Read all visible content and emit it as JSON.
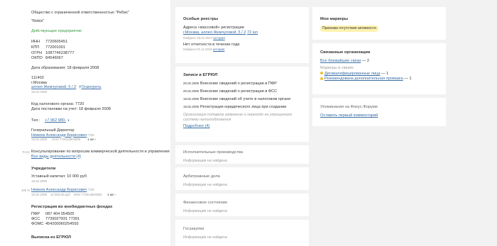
{
  "company": {
    "full_name": "Общество с ограниченной ответственностью \"Ребис\"",
    "short_name": "\"Rebis\"",
    "status": "Действующее предприятие",
    "inn_label": "ИНН",
    "inn": "7720605451",
    "kpp_label": "КПП",
    "kpp": "772001001",
    "ogrn_label": "ОГРН",
    "ogrn": "1087746238777",
    "okpo_label": "ОКПО",
    "okpo": "84546067",
    "formation": "Дата образования: 18 февраля 2008",
    "addr_index": "111402",
    "addr_city": "г.Москва",
    "addr_street": "аллея Жемчуговой, 5 / 2",
    "addr_map": "Осмотреть",
    "addr_date": "18.02.2008",
    "tax_code": "Код налогового органа: 7720",
    "tax_date": "Дата постановки на учет: 18 февраля 2008",
    "phone_label": "Тел.:",
    "phone": "+7 962 980-",
    "director_title": "Генеральный Директор",
    "director_name": "Невеев Александр Борисович",
    "director_suffix": "ТЭЛ",
    "director_date": "18.02.2008",
    "director_inn": "ИНН 772014804800",
    "director_more": "1 юл",
    "okved_code": "70.22",
    "okved_text": "Консультирование по вопросам коммерческой деятельности и управления",
    "okved_all": "Все виды деятельности (4)",
    "founders_title": "Учредители",
    "capital": "Уставный капитал: 10 000 руб",
    "capital_date": "18.02.2008",
    "founder_share": "100 %",
    "founder_name": "Невеев Александр Борисович",
    "founder_suffix": "ТЭЛ",
    "founder_date": "18.02.2008",
    "founder_amount": "10 000,00 руб",
    "founder_inn": "ИНН 772014804800",
    "founder_more": "1 юл",
    "funds_title": "Регистрация во внебюджетных фондах",
    "pfr_label": "ПФР",
    "pfr": "087 404 054505",
    "fss_label": "ФСС",
    "fss": "773902?931 77391",
    "foms_label": "ФОМС",
    "foms": "454200060254593",
    "egrul_title": "Выписка из ЕГРЮЛ"
  },
  "special": {
    "title": "Особые реестры",
    "addr_title": "Адреса «массовой» регистрации",
    "addr_link": "г.Москва, аллея Жемчуговой, 5 / 2",
    "addr_count": "72 юл",
    "addr_found": "Найдено 15.01.2017",
    "addr_history": "история",
    "report_title": "Нет отчетности в течение года",
    "report_found": "Найдено 01.11.2016",
    "report_history": "история"
  },
  "egrul": {
    "title": "Записи в ЕГРЮЛ",
    "records": [
      {
        "date": "20.02.2008",
        "text": "Внесение сведений о регистрации в ПФР"
      },
      {
        "date": "20.02.2008",
        "text": "Внесение сведений о регистрации в ФСС"
      },
      {
        "date": "18.02.2008",
        "text": "Внесение сведений об учете в налоговом органе"
      },
      {
        "date": "18.02.2008",
        "text": "Регистрация юридического лица при создании"
      }
    ],
    "note": "Организация подавала заявление о переходе на упрощенную систему налогообложения",
    "more": "Подробнее (4)"
  },
  "panels": [
    {
      "title": "Исполнительные производства",
      "empty": "Информация не найдена"
    },
    {
      "title": "Арбитражные дела",
      "empty": "Информация не найдена"
    },
    {
      "title": "Финансовое состояние",
      "empty": "Информация не найдена"
    },
    {
      "title": "Госзакупки",
      "empty": "Информация не найдена"
    }
  ],
  "markers": {
    "title": "Мои маркеры",
    "badge": "Признаки отсутствия активности"
  },
  "related": {
    "title": "Связанные организации",
    "all_links": "Все ближайшие связи",
    "all_count": "— 2",
    "markers_label": "Маркеры в связях",
    "m1": "Дисквалифицированные лица",
    "m1_count": "— 1",
    "m2": "Рекомендована дополнительная проверка",
    "m2_count": "— 1"
  },
  "focus": {
    "title": "Упоминания на Фокус.Форуме",
    "link": "Оставить первый комментарий"
  },
  "colors": {
    "green": "#3d9a47",
    "link": "#3a6ea5",
    "yellow": "#f0c22f",
    "badge": "#fff3b0"
  }
}
